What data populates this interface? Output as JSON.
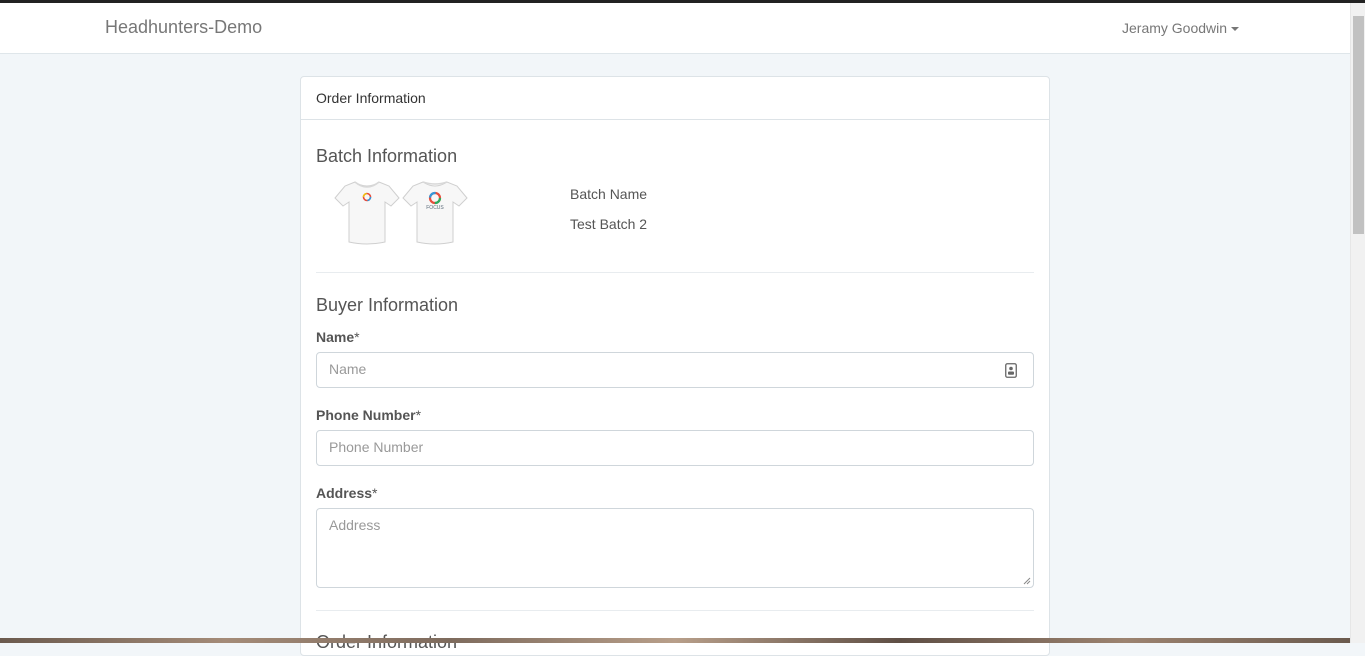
{
  "navbar": {
    "brand": "Headhunters-Demo",
    "user_name": "Jeramy Goodwin"
  },
  "panel": {
    "heading": "Order Information"
  },
  "batch": {
    "title": "Batch Information",
    "name_label": "Batch Name",
    "name_value": "Test Batch 2",
    "logo_text": "FOCUS"
  },
  "buyer": {
    "title": "Buyer Information",
    "name_label": "Name",
    "name_placeholder": "Name",
    "phone_label": "Phone Number",
    "phone_placeholder": "Phone Number",
    "address_label": "Address",
    "address_placeholder": "Address",
    "required_mark": "*"
  },
  "next_section": {
    "title": "Order Information"
  },
  "colors": {
    "page_bg": "#f2f6f9",
    "panel_border": "#dde3e7",
    "text": "#555555"
  }
}
